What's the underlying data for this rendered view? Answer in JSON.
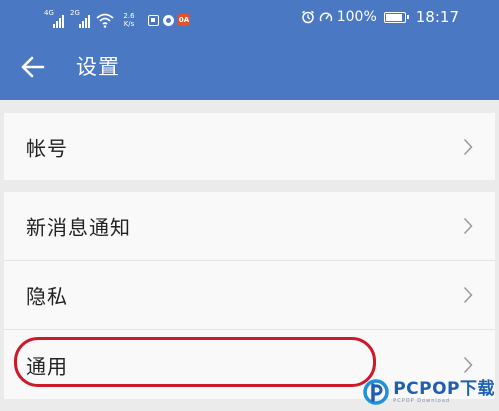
{
  "status_bar": {
    "sim1_tag": "4G",
    "sim2_tag": "2G",
    "net_speed_value": "2.6",
    "net_speed_unit": "K/s",
    "notif_red_label": "0A",
    "battery_percent": "100%",
    "battery_level": 1.0,
    "time": "18:17",
    "icons": [
      "signal-icon",
      "signal-icon",
      "wifi-icon",
      "notification-icon",
      "circle-icon",
      "app-notification-icon",
      "alarm-icon",
      "speed-icon",
      "battery-icon"
    ]
  },
  "app_bar": {
    "title": "设置",
    "back_icon": "back-arrow-icon",
    "color": "#4a78c2"
  },
  "settings": {
    "group1": [
      {
        "label": "帐号"
      }
    ],
    "group2": [
      {
        "label": "新消息通知"
      },
      {
        "label": "隐私"
      },
      {
        "label": "通用"
      }
    ]
  },
  "highlight": {
    "target": "通用",
    "color": "#cc1a2a"
  },
  "watermark": {
    "main": "PCPOP下载",
    "sub": "PCPOP Download"
  }
}
